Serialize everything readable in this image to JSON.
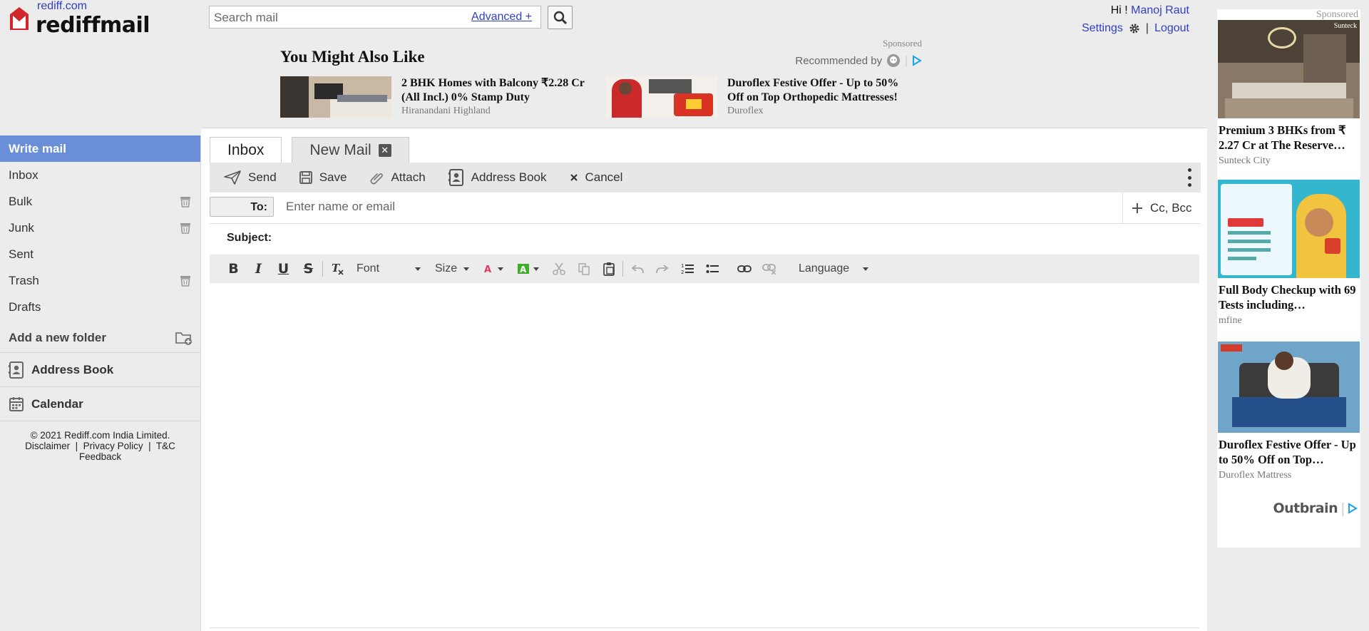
{
  "header": {
    "site_link": "rediff.com",
    "logo_text": "rediffmail",
    "search_placeholder": "Search mail",
    "advanced_label": "Advanced +",
    "greeting": "Hi !",
    "username": "Manoj Raut",
    "settings_label": "Settings",
    "logout_label": "Logout",
    "separator": "|"
  },
  "reco": {
    "sponsored": "Sponsored",
    "title": "You Might Also Like",
    "recommended_by": "Recommended by",
    "items": [
      {
        "title": "2 BHK Homes with Balcony ₹2.28 Cr (All Incl.) 0% Stamp Duty",
        "source": "Hiranandani Highland"
      },
      {
        "title": "Duroflex Festive Offer - Up to 50% Off on Top Orthopedic Mattresses!",
        "source": "Duroflex"
      }
    ]
  },
  "sidebar": {
    "write_label": "Write mail",
    "folders": [
      {
        "label": "Inbox",
        "icon": "none"
      },
      {
        "label": "Bulk",
        "icon": "trash-bin-icon"
      },
      {
        "label": "Junk",
        "icon": "trash-bin-icon"
      },
      {
        "label": "Sent",
        "icon": "none"
      },
      {
        "label": "Trash",
        "icon": "trash-bin-icon"
      },
      {
        "label": "Drafts",
        "icon": "none"
      }
    ],
    "add_folder_label": "Add a new folder",
    "address_book_label": "Address Book",
    "calendar_label": "Calendar",
    "copyright": "© 2021 Rediff.com India Limited.",
    "links": [
      "Disclaimer",
      "Privacy Policy",
      "T&C"
    ],
    "feedback": "Feedback"
  },
  "compose": {
    "tabs": [
      "Inbox",
      "New Mail"
    ],
    "toolbar": {
      "send": "Send",
      "save": "Save",
      "attach": "Attach",
      "address_book": "Address Book",
      "cancel": "Cancel"
    },
    "to_label": "To:",
    "to_placeholder": "Enter name or email",
    "cc_bcc_label": "Cc, Bcc",
    "subject_label": "Subject:",
    "format": {
      "font_label": "Font",
      "size_label": "Size",
      "language_label": "Language"
    }
  },
  "right_ads": {
    "sponsored": "Sponsored",
    "brand_corner": "Sunteck",
    "items": [
      {
        "title": "Premium 3 BHKs from ₹ 2.27 Cr at The Reserve…",
        "source": "Sunteck City"
      },
      {
        "title": "Full Body Checkup with 69 Tests including…",
        "source": "mfine"
      },
      {
        "title": "Duroflex Festive Offer - Up to 50% Off on Top…",
        "source": "Duroflex Mattress"
      }
    ],
    "powered_by": "Outbrain"
  },
  "colors": {
    "accent": "#6b8ed8",
    "link": "#3140c4",
    "background": "#ececec"
  }
}
